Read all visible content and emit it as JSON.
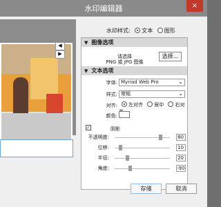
{
  "window": {
    "title": "水印编辑器",
    "close_icon": "×"
  },
  "nav": {
    "prev": "◀",
    "next": "▶"
  },
  "watermark_style": {
    "label": "水印样式:",
    "options": [
      {
        "label": "文本",
        "selected": true
      },
      {
        "label": "图形",
        "selected": false
      }
    ]
  },
  "image_section": {
    "title": "图像选项",
    "hint_line1": "请选择",
    "hint_line2": "PNG 或 JPG 图像",
    "choose_button": "选择..."
  },
  "text_section": {
    "title": "文本选项",
    "font_label": "字体:",
    "font_value": "Myriad Web Pro",
    "style_label": "样式:",
    "style_value": "常规",
    "align_label": "对齐:",
    "align_options": [
      {
        "label": "左对齐",
        "selected": true
      },
      {
        "label": "居中",
        "selected": false
      },
      {
        "label": "右对齐",
        "selected": false
      }
    ],
    "color_label": "颜色:",
    "color_value": "#ffffff"
  },
  "shadow": {
    "checked": true,
    "label": "阴影",
    "rows": [
      {
        "label": "不透明度:",
        "value": "80",
        "fraction": 0.8
      },
      {
        "label": "位移:",
        "value": "10",
        "fraction": 0.1
      },
      {
        "label": "半径:",
        "value": "20",
        "fraction": 0.2
      },
      {
        "label": "角度:",
        "value": "-90",
        "fraction": 0.25
      }
    ]
  },
  "buttons": {
    "save": "存储",
    "cancel": "取消"
  },
  "colors": {
    "titlebar": "#8a8a8a",
    "close": "#c0392b",
    "accent": "#67a7d8"
  }
}
